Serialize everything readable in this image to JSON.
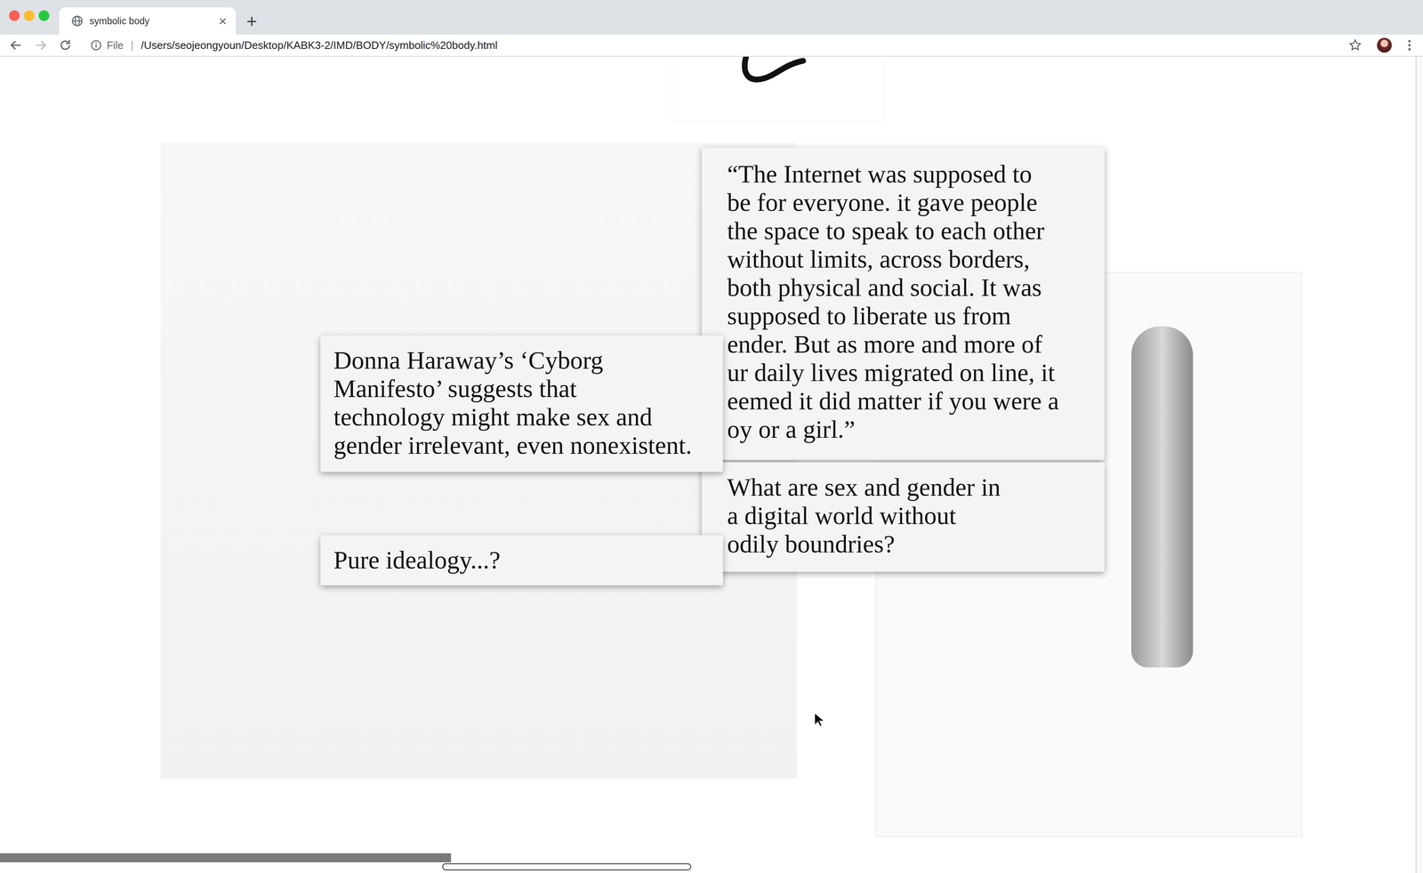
{
  "window": {
    "title": "symbolic body"
  },
  "tabs": [
    {
      "label": "symbolic body",
      "selected": true,
      "close": "×"
    }
  ],
  "new_tab": "+",
  "address_bar": {
    "scheme_label": "File",
    "separator": "|",
    "url": "/Users/seojeongyoun/Desktop/KABK3-2/IMD/BODY/symbolic%20body.html"
  },
  "cards": [
    {
      "lines": [
        "“The Internet was supposed to",
        "be for everyone. it gave people",
        "the space to speak to each other",
        "without limits, across borders,",
        "both physical and social. It was",
        "supposed to liberate us from",
        "ender. But as more and more of",
        "ur daily lives migrated on line, it",
        "eemed it did matter if you were a",
        "oy or a girl.”"
      ]
    },
    {
      "lines": [
        "What are sex and gender in",
        "a digital world without",
        "odily boundries?"
      ]
    },
    {
      "lines": [
        "Donna Haraway’s ‘Cyborg",
        "Manifesto’ suggests that",
        "technology might make sex and",
        "gender irrelevant, even nonexistent."
      ]
    },
    {
      "lines": [
        "Pure idealogy...?"
      ]
    }
  ]
}
